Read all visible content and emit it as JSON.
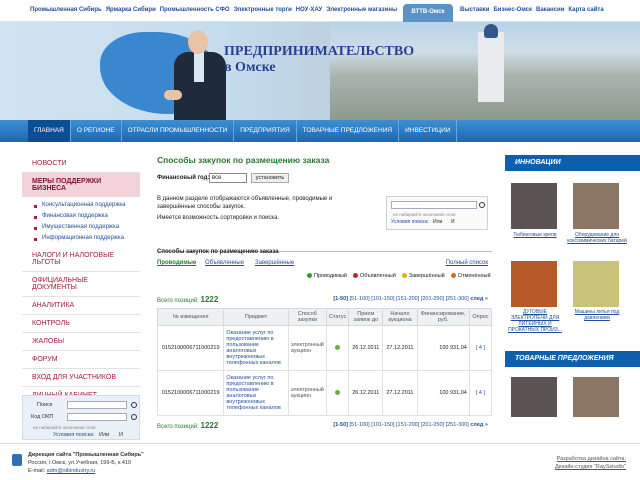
{
  "topnav": {
    "left": [
      "Промышленная Сибирь",
      "Ярмарка Сибири",
      "Промышленность СФО",
      "Электронные торги",
      "НОУ-ХАУ",
      "Электронные магазины"
    ],
    "active": "ВТТВ-Омск",
    "right": [
      "Выставки",
      "Бизнес-Омск",
      "Вакансии",
      "Карта сайта"
    ]
  },
  "hero": {
    "title": "ПРЕДПРИНИМАТЕЛЬСТВО",
    "subtitle": "в Омске"
  },
  "mainnav": [
    "ГЛАВНАЯ",
    "О РЕГИОНЕ",
    "ОТРАСЛИ ПРОМЫШЛЕННОСТИ",
    "ПРЕДПРИЯТИЯ",
    "ТОВАРНЫЕ ПРЕДЛОЖЕНИЯ",
    "ИНВЕСТИЦИИ"
  ],
  "left": {
    "items": [
      "НОВОСТИ",
      "МЕРЫ ПОДДЕРЖКИ БИЗНЕСА"
    ],
    "subs": [
      "Консультационная поддержка",
      "Финансовая поддержка",
      "Имущественная поддержка",
      "Информационная поддержка"
    ],
    "items2": [
      "НАЛОГИ И НАЛОГОВЫЕ ЛЬГОТЫ",
      "ОФИЦИАЛЬНЫЕ ДОКУМЕНТЫ",
      "АНАЛИТИКА",
      "КОНТРОЛЬ",
      "ЖАЛОБЫ",
      "ФОРУМ",
      "ВХОД ДЛЯ УЧАСТНИКОВ",
      "ЛИЧНЫЙ КАБИНЕТ"
    ]
  },
  "search": {
    "label1": "Поиск",
    "label2": "Код ОКП",
    "hint": "не набирайте окончания слов",
    "mode": "Условия поиска:",
    "or": "Или",
    "and": "И"
  },
  "center": {
    "title": "Способы закупок по размещению заказа",
    "year_label": "Финансовый год:",
    "year": "все",
    "btn": "установить",
    "desc1": "В данном разделе отображаются объявленные, проводимые и завершённые способы закупок.",
    "desc2": "Имеется возможность сортировки и поиска.",
    "mini_hint": "не набирайте окончания слов",
    "mini_mode": "Условия поиска:",
    "mini_or": "Или",
    "mini_and": "И",
    "sub": "Способы закупок по размещению заказа",
    "tabs": [
      "Проводимые",
      "Объявленные",
      "Завершённые"
    ],
    "full": "Полный список",
    "legend": [
      "Проводимый",
      "Объявленный",
      "Завершённый",
      "Отменённый"
    ],
    "total_label": "Всего позиций:",
    "total": "1222",
    "pager": [
      "[1-50]",
      "[51-100]",
      "[101-150]",
      "[151-200]",
      "[201-250]",
      "[251-300]",
      "след »"
    ],
    "cols": [
      "№ извещения",
      "Предмет",
      "Способ закупки",
      "Статус",
      "Прием заявок до",
      "Начало аукциона",
      "Финансирование, руб.",
      "Опрос"
    ],
    "rows": [
      {
        "num": "0152100006711000219",
        "subj": "Оказание услуг по предоставлению в пользование аналоговых внутризоновых телефонных каналов",
        "way": "электронный аукцион",
        "d1": "26.12.2011",
        "d2": "27.12.2011",
        "sum": "100 931,04",
        "q": "[ 4 ]"
      },
      {
        "num": "0152100006711000219",
        "subj": "Оказание услуг по предоставлению в пользование аналоговых внутризоновых телефонных каналов",
        "way": "электронный аукцион",
        "d1": "26.12.2011",
        "d2": "27.12.2011",
        "sum": "100 931,04",
        "q": "[ 4 ]"
      }
    ]
  },
  "right": {
    "h1": "ИННОВАЦИИ",
    "caps": [
      "Тюбинговые крепи",
      "Оборудование для коксохимических батарей",
      "ДУГОВЫЕ ЭЛЕКТРОПЕЧИ ДЛЯ ЛИТЕЙНЫХ И ПРОКАТНЫХ ПРОИЗ...",
      "Машины литья под давлением"
    ],
    "h2": "ТОВАРНЫЕ ПРЕДЛОЖЕНИЯ"
  },
  "footer": {
    "org": "Дирекция сайта \"Промышленная Сибирь\"",
    "addr": "Россия, г.Омск, ул.Учебная, 199-Б, к.410",
    "email_label": "E-mail:",
    "email": "adm@sibindustry.ru",
    "dev": "Разработка дизайна сайта:",
    "studio": "Дизайн-студия \"RaySstudio\""
  }
}
